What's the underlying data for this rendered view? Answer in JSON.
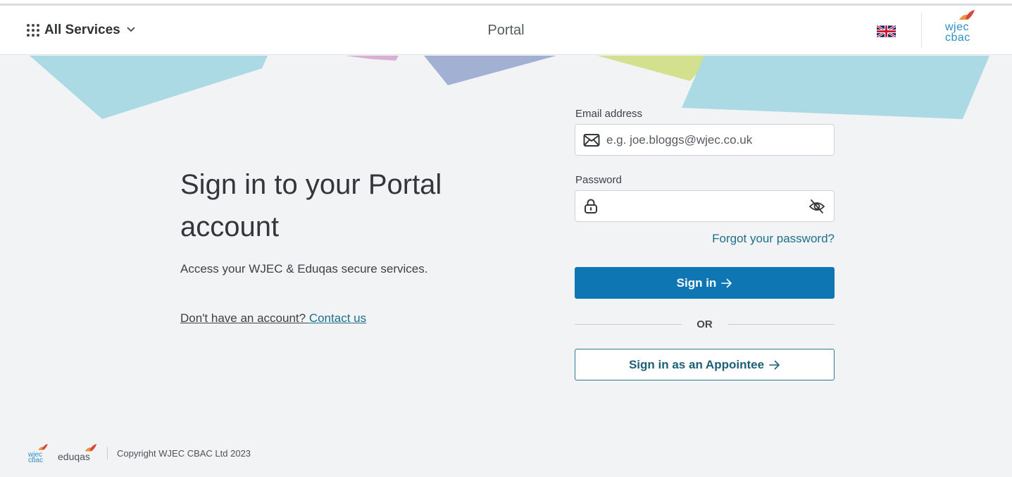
{
  "header": {
    "services_label": "All Services",
    "portal_title": "Portal",
    "language_flag": "uk-flag-icon",
    "logo_text_top": "wjec",
    "logo_text_bottom": "cbac"
  },
  "main": {
    "title": "Sign in to your Portal account",
    "subtitle": "Access your WJEC & Eduqas secure services.",
    "no_account_text": "Don't have an account?",
    "contact_link": "Contact us"
  },
  "form": {
    "email_label": "Email address",
    "email_placeholder": "e.g. joe.bloggs@wjec.co.uk",
    "email_value": "",
    "password_label": "Password",
    "password_value": "",
    "forgot_link": "Forgot your password?",
    "sign_in_label": "Sign in",
    "or_text": "OR",
    "appointee_label": "Sign in as an Appointee"
  },
  "footer": {
    "wjec_top": "wjec",
    "wjec_bottom": "cbac",
    "eduqas": "eduqas",
    "copyright": "Copyright WJEC CBAC Ltd 2023"
  },
  "colors": {
    "primary": "#0e77b3",
    "link": "#1d6f89",
    "background": "#f2f3f5",
    "shape_blue": "#abdae5",
    "shape_purple": "#a2b0d4",
    "shape_green": "#d3e18f",
    "shape_pink": "#d9b0d4"
  }
}
